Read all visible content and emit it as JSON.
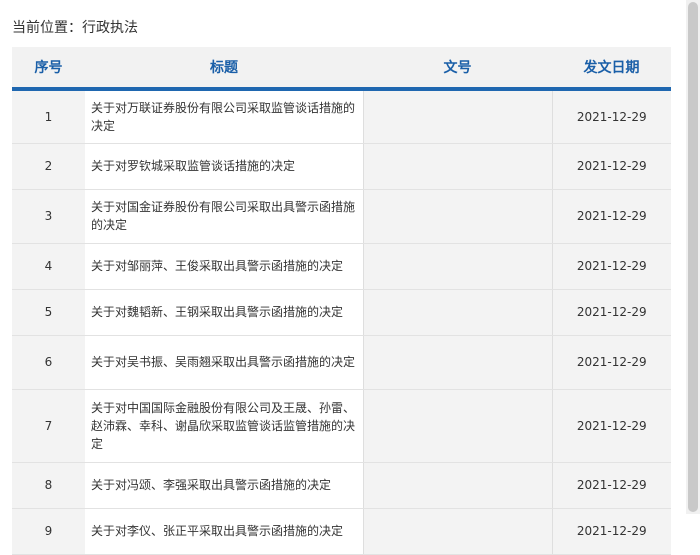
{
  "breadcrumb": "当前位置：行政执法",
  "table": {
    "headers": {
      "seq": "序号",
      "title": "标题",
      "docno": "文号",
      "date": "发文日期"
    },
    "rows": [
      {
        "seq": "1",
        "title": "关于对万联证券股份有限公司采取监管谈话措施的决定",
        "docno": "",
        "date": "2021-12-29"
      },
      {
        "seq": "2",
        "title": "关于对罗钦城采取监管谈话措施的决定",
        "docno": "",
        "date": "2021-12-29"
      },
      {
        "seq": "3",
        "title": "关于对国金证券股份有限公司采取出具警示函措施的决定",
        "docno": "",
        "date": "2021-12-29"
      },
      {
        "seq": "4",
        "title": "关于对邹丽萍、王俊采取出具警示函措施的决定",
        "docno": "",
        "date": "2021-12-29"
      },
      {
        "seq": "5",
        "title": "关于对魏韬新、王钢采取出具警示函措施的决定",
        "docno": "",
        "date": "2021-12-29"
      },
      {
        "seq": "6",
        "title": "关于对吴书振、吴雨翘采取出具警示函措施的决定",
        "docno": "",
        "date": "2021-12-29"
      },
      {
        "seq": "7",
        "title": "关于对中国国际金融股份有限公司及王晟、孙雷、赵沛霖、幸科、谢晶欣采取监管谈话监管措施的决定",
        "docno": "",
        "date": "2021-12-29"
      },
      {
        "seq": "8",
        "title": "关于对冯颂、李强采取出具警示函措施的决定",
        "docno": "",
        "date": "2021-12-29"
      },
      {
        "seq": "9",
        "title": "关于对李仪、张正平采取出具警示函措施的决定",
        "docno": "",
        "date": "2021-12-29"
      }
    ]
  }
}
